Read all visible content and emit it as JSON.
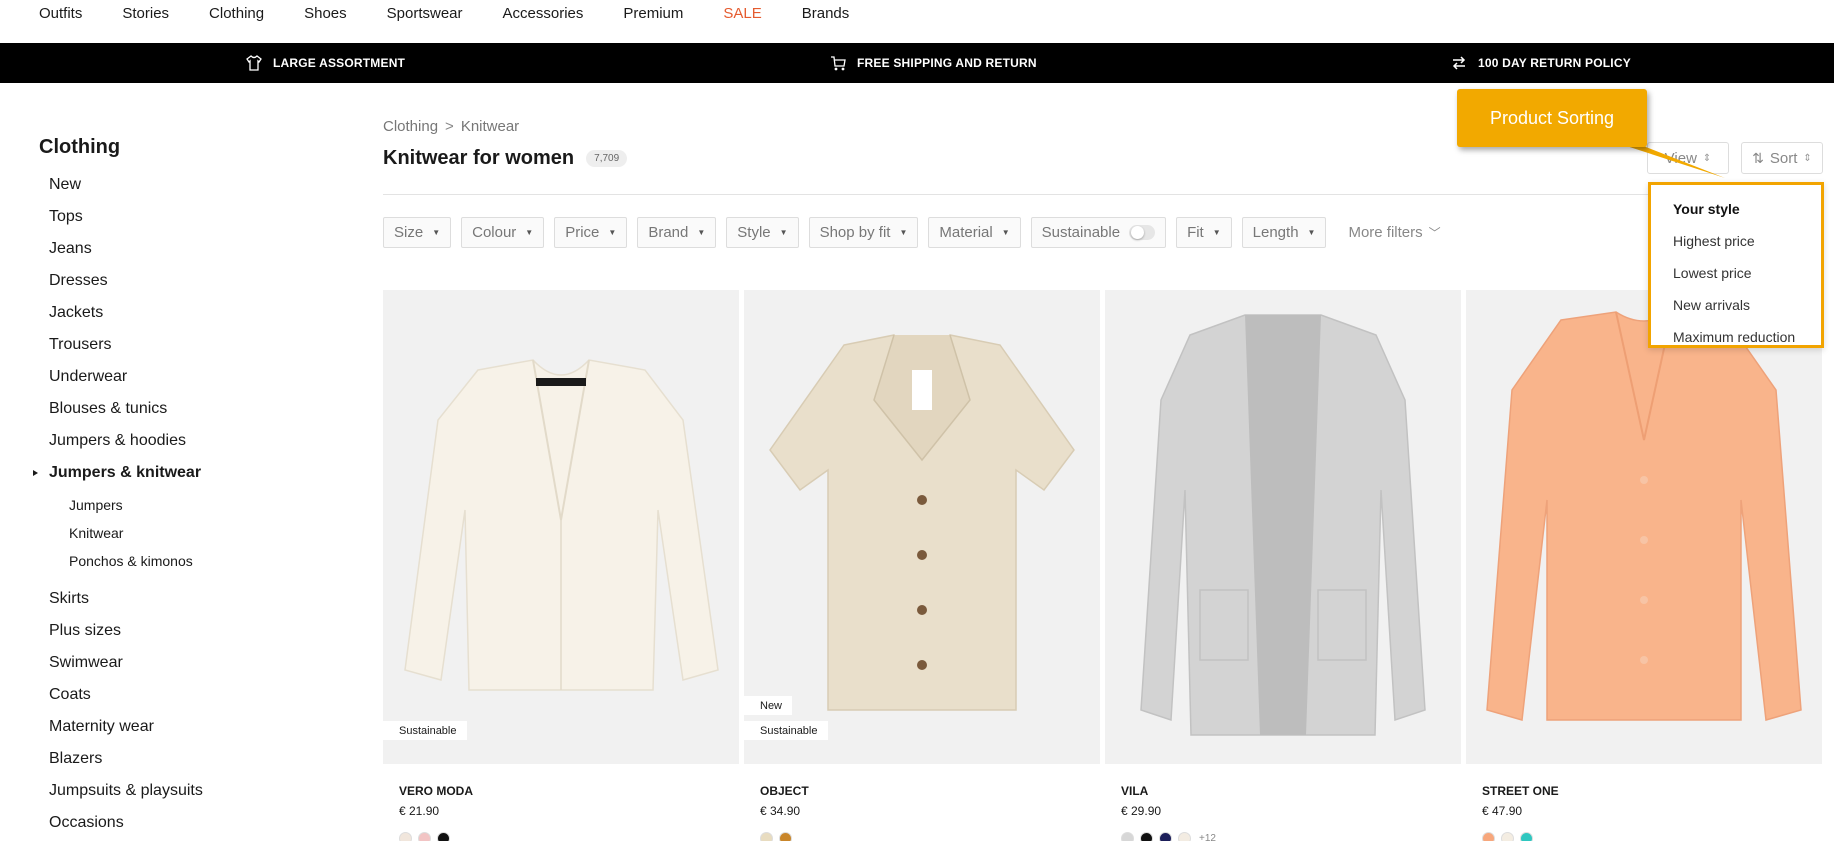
{
  "nav": {
    "items": [
      {
        "label": "Outfits",
        "name": "nav-outfits"
      },
      {
        "label": "Stories",
        "name": "nav-stories"
      },
      {
        "label": "Clothing",
        "name": "nav-clothing"
      },
      {
        "label": "Shoes",
        "name": "nav-shoes"
      },
      {
        "label": "Sportswear",
        "name": "nav-sportswear"
      },
      {
        "label": "Accessories",
        "name": "nav-accessories"
      },
      {
        "label": "Premium",
        "name": "nav-premium"
      },
      {
        "label": "SALE",
        "name": "nav-sale"
      },
      {
        "label": "Brands",
        "name": "nav-brands"
      }
    ]
  },
  "usp": {
    "assortment": "LARGE ASSORTMENT",
    "shipping": "FREE SHIPPING AND RETURN",
    "returns": "100 DAY RETURN POLICY"
  },
  "sidebar": {
    "title": "Clothing",
    "categories_top": [
      "New",
      "Tops",
      "Jeans",
      "Dresses",
      "Jackets",
      "Trousers",
      "Underwear",
      "Blouses & tunics",
      "Jumpers & hoodies"
    ],
    "active": "Jumpers & knitwear",
    "subcategories": [
      "Jumpers",
      "Knitwear",
      "Ponchos & kimonos"
    ],
    "categories_bottom": [
      "Skirts",
      "Plus sizes",
      "Swimwear",
      "Coats",
      "Maternity wear",
      "Blazers",
      "Jumpsuits & playsuits",
      "Occasions"
    ]
  },
  "breadcrumb": {
    "parent": "Clothing",
    "separator": ">",
    "current": "Knitwear"
  },
  "page": {
    "title": "Knitwear for women",
    "count": "7,709"
  },
  "toolbar": {
    "view_label": "View",
    "sort_label": "Sort"
  },
  "filters": {
    "size": "Size",
    "colour": "Colour",
    "price": "Price",
    "brand": "Brand",
    "style": "Style",
    "fit_shop": "Shop by fit",
    "material": "Material",
    "sustainable": "Sustainable",
    "fit": "Fit",
    "length": "Length",
    "more": "More filters"
  },
  "sort_menu": {
    "options": [
      "Your style",
      "Highest price",
      "Lowest price",
      "New arrivals",
      "Maximum reduction"
    ],
    "selected": "Your style"
  },
  "callout": {
    "text": "Product Sorting"
  },
  "products": [
    {
      "brand": "VERO MODA",
      "price": "€ 21.90",
      "badges": [
        "Sustainable"
      ],
      "swatches": [
        "#f1e6dc",
        "#f2c4c4",
        "#111111"
      ],
      "more_colors": ""
    },
    {
      "brand": "OBJECT",
      "price": "€ 34.90",
      "badges": [
        "New",
        "Sustainable"
      ],
      "swatches": [
        "#e8dcc0",
        "#c9862a"
      ],
      "more_colors": ""
    },
    {
      "brand": "VILA",
      "price": "€ 29.90",
      "badges": [],
      "swatches": [
        "#d7d7d7",
        "#111111",
        "#1c1f5a",
        "#f3ece2"
      ],
      "more_colors": "+12"
    },
    {
      "brand": "STREET ONE",
      "price": "€ 47.90",
      "badges": [],
      "swatches": [
        "#f7a77c",
        "#f4ede2",
        "#2fc7c0"
      ],
      "more_colors": ""
    }
  ],
  "colors": {
    "accent": "#f2a900",
    "sale": "#e55b2f"
  }
}
